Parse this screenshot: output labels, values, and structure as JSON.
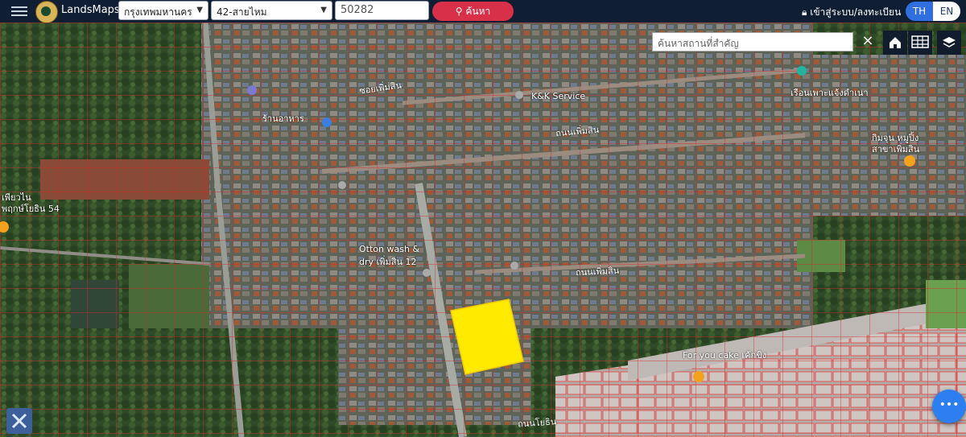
{
  "header": {
    "brand": "LandsMaps",
    "province": "กรุงเทพมหานคร",
    "district": "42-สายไหม",
    "parcel_number": "50282",
    "search_label": "ค้นหา",
    "login_label": "เข้าสู่ระบบ/ลงทะเบียน",
    "lang_th": "TH",
    "lang_en": "EN"
  },
  "map": {
    "place_search_placeholder": "ค้นหาสถานที่สำคัญ",
    "clear_label": "×",
    "highlight_color": "#ffea00",
    "labels": {
      "kk_service": "K&K Service",
      "otton_wash": "Otton wash &",
      "otton_wash2": "dry เพิ่มสิน 12",
      "for_you_cake": "For you cake เค้กขิง",
      "kimjun": "กิมจุน หมูปิ้ง",
      "kimjun2": "สาขาเพิ่มสิน",
      "road1": "ถนนเพิ่มสิน",
      "road2": "ซอยเพิ่มสิน",
      "road3": "ถนนเพิ่มสิน",
      "road4": "ถนนโยธิน",
      "nursery": "เรือนเพาะแจ้งดำเนา",
      "restaurant": "ร้านอาหาร",
      "left_label": "เพียวไน",
      "left_label2": "พฤกษ์โยธิน 54"
    }
  }
}
